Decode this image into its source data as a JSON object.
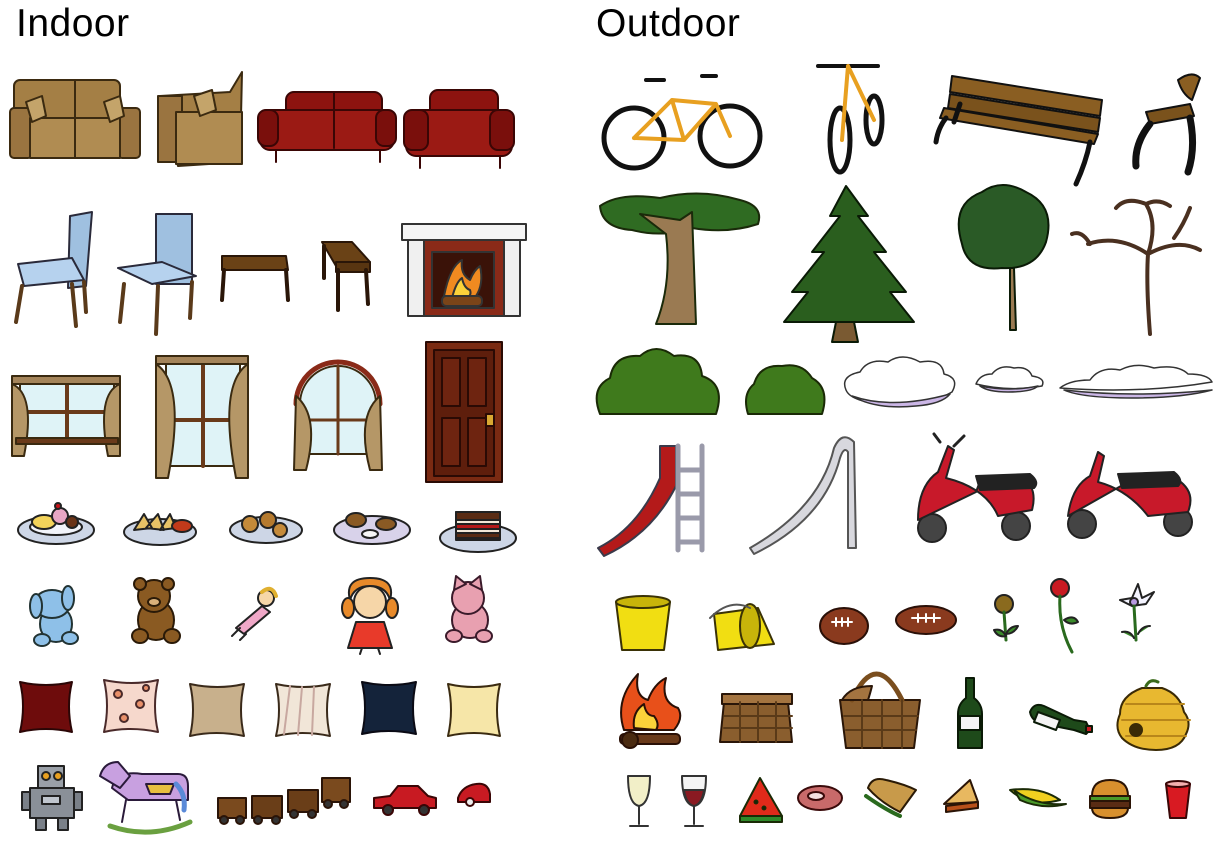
{
  "sections": {
    "indoor": {
      "title": "Indoor"
    },
    "outdoor": {
      "title": "Outdoor"
    }
  },
  "palette": {
    "tan": "#a47f45",
    "dark_red": "#8d130f",
    "chair_blue": "#9fc0e0",
    "wood": "#6a4216",
    "tree_green": "#2f6b22",
    "bush_green": "#3f7a1c",
    "cloud_lavender": "#cbb6e6",
    "scooter_red": "#c8192a",
    "slide_red": "#b41a1a",
    "bucket_yellow": "#f1de12"
  },
  "rows": {
    "indoor": [
      [
        "sofa-icon",
        "armchair-icon",
        "sofa-icon",
        "armchair-icon"
      ],
      [
        "chair-icon",
        "chair-icon",
        "side-table-icon",
        "side-table-icon",
        "fireplace-icon"
      ],
      [
        "window-icon",
        "window-icon",
        "arched-window-icon",
        "door-icon"
      ],
      [
        "dessert-plate-icon",
        "nachos-plate-icon",
        "cookies-plate-icon",
        "chicken-plate-icon",
        "cake-plate-icon"
      ],
      [
        "stuffed-bunny-icon",
        "teddy-bear-icon",
        "doll-icon",
        "doll-icon",
        "stuffed-cat-icon"
      ],
      [
        "pillow-icon",
        "pillow-icon",
        "pillow-icon",
        "pillow-icon",
        "pillow-icon",
        "pillow-icon"
      ],
      [
        "robot-icon",
        "rocking-horse-icon",
        "toy-train-icon",
        "toy-car-icon",
        "toy-car-icon"
      ]
    ],
    "outdoor": [
      [
        "bicycle-icon",
        "bicycle-icon",
        "park-bench-icon",
        "park-bench-icon"
      ],
      [
        "tree-icon",
        "pine-tree-icon",
        "tree-icon",
        "bare-tree-icon"
      ],
      [
        "bush-icon",
        "bush-icon",
        "cloud-icon",
        "cloud-icon",
        "cloud-icon"
      ],
      [
        "slide-icon",
        "slide-icon",
        "scooter-icon",
        "scooter-icon"
      ],
      [
        "bucket-icon",
        "bucket-icon",
        "football-icon",
        "football-icon",
        "flower-icon",
        "rose-icon",
        "flower-icon"
      ],
      [
        "campfire-icon",
        "picnic-basket-icon",
        "picnic-basket-icon",
        "wine-bottle-icon",
        "wine-bottle-icon",
        "beehive-icon"
      ],
      [
        "wine-glass-icon",
        "wine-glass-icon",
        "watermelon-icon",
        "steak-icon",
        "sandwich-icon",
        "pie-slice-icon",
        "corn-icon",
        "hamburger-icon",
        "cup-icon"
      ]
    ]
  }
}
